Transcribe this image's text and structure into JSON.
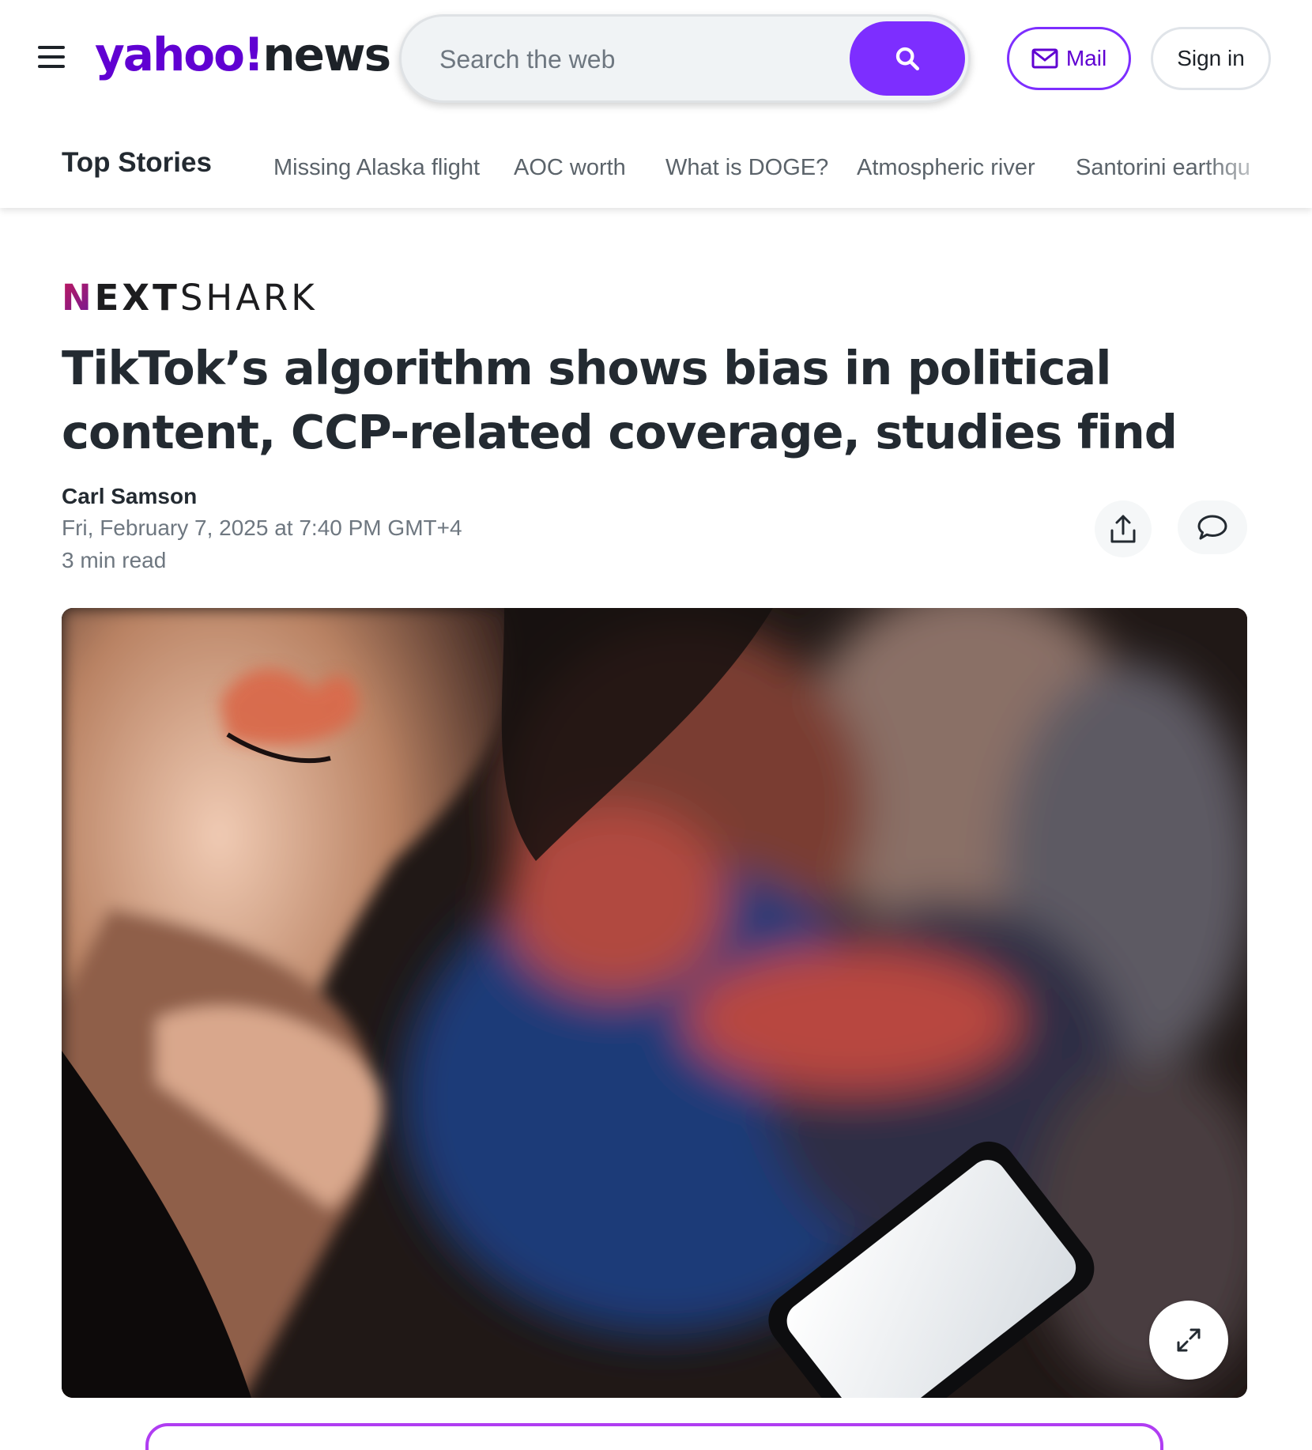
{
  "header": {
    "logo_yahoo": "yahoo!",
    "logo_news": "news",
    "search_placeholder": "Search the web",
    "mail_label": "Mail",
    "signin_label": "Sign in"
  },
  "nav": {
    "top_stories": "Top Stories",
    "trending": [
      "Missing Alaska flight",
      "AOC worth",
      "What is DOGE?",
      "Atmospheric river",
      "Santorini earthqu"
    ]
  },
  "article": {
    "publisher_first": "N",
    "publisher_bold": "EXT",
    "publisher_rest": "SHARK",
    "headline": "TikTok’s algorithm shows bias in political content, CCP-related coverage, studies find",
    "author": "Carl Samson",
    "date": "Fri, February 7, 2025 at 7:40 PM GMT+4",
    "read_time": "3 min read"
  },
  "colors": {
    "brand_purple": "#6001d2",
    "button_purple": "#7d2eff",
    "text_dark": "#232a31",
    "text_gray": "#6e7780"
  },
  "icons": [
    "menu-icon",
    "search-icon",
    "mail-icon",
    "share-icon",
    "comment-icon",
    "expand-icon"
  ]
}
